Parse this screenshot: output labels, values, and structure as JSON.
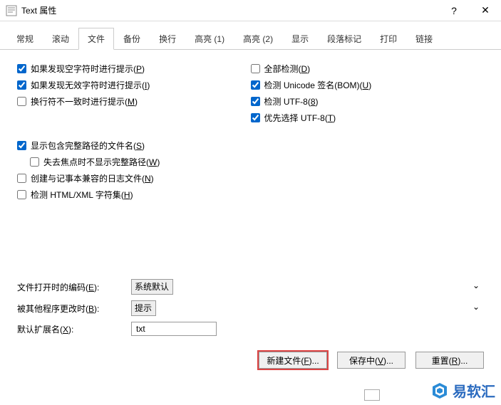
{
  "titlebar": {
    "title": "Text 属性",
    "help": "?",
    "close": "✕"
  },
  "tabs": [
    "常规",
    "滚动",
    "文件",
    "备份",
    "换行",
    "高亮 (1)",
    "高亮 (2)",
    "显示",
    "段落标记",
    "打印",
    "链接"
  ],
  "active_tab": 2,
  "left_checks": [
    {
      "label": "如果发现空字符时进行提示(",
      "accel": "P",
      "tail": ")",
      "checked": true
    },
    {
      "label": "如果发现无效字符时进行提示(",
      "accel": "I",
      "tail": ")",
      "checked": true
    },
    {
      "label": "换行符不一致时进行提示(",
      "accel": "M",
      "tail": ")",
      "checked": false
    }
  ],
  "right_checks": [
    {
      "label": "全部检测(",
      "accel": "D",
      "tail": ")",
      "checked": false
    },
    {
      "label": "检测 Unicode 签名(BOM)(",
      "accel": "U",
      "tail": ")",
      "checked": true
    },
    {
      "label": "检测 UTF-8(",
      "accel": "8",
      "tail": ")",
      "checked": true
    },
    {
      "label": "优先选择 UTF-8(",
      "accel": "T",
      "tail": ")",
      "checked": true
    }
  ],
  "left_checks2": [
    {
      "label": "显示包含完整路径的文件名(",
      "accel": "S",
      "tail": ")",
      "checked": true
    },
    {
      "label": "失去焦点时不显示完整路径(",
      "accel": "W",
      "tail": ")",
      "checked": false,
      "indent": true
    },
    {
      "label": "创建与记事本兼容的日志文件(",
      "accel": "N",
      "tail": ")",
      "checked": false
    },
    {
      "label": "检测 HTML/XML 字符集(",
      "accel": "H",
      "tail": ")",
      "checked": false
    }
  ],
  "form": {
    "encoding_label": "文件打开时的编码(",
    "encoding_accel": "E",
    "encoding_tail": "):",
    "encoding_value": "系统默认",
    "changed_label": "被其他程序更改时(",
    "changed_accel": "B",
    "changed_tail": "):",
    "changed_value": "提示",
    "ext_label": "默认扩展名(",
    "ext_accel": "X",
    "ext_tail": "):",
    "ext_value": "txt"
  },
  "buttons": {
    "new": "新建文件(",
    "new_accel": "F",
    "new_tail": ")...",
    "save": "保存中(",
    "save_accel": "V",
    "save_tail": ")...",
    "reset": "重置(",
    "reset_accel": "R",
    "reset_tail": ")..."
  },
  "watermark": "易软汇"
}
